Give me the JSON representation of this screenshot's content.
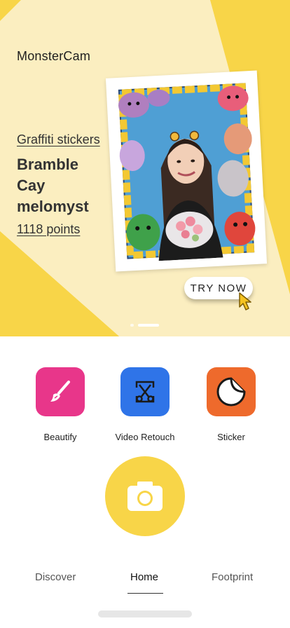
{
  "app": {
    "title": "MonsterCam"
  },
  "banner": {
    "category": "Graffiti stickers",
    "name": "Bramble Cay melomyst",
    "points": "1118 points",
    "cta": "TRY NOW",
    "colors": {
      "yellow": "#f8d548",
      "cream": "#fbeec0"
    }
  },
  "features": [
    {
      "label": "Beautify",
      "icon": "brush-icon",
      "color": "#e8368a"
    },
    {
      "label": "Video Retouch",
      "icon": "video-cut-icon",
      "color": "#2f74e8"
    },
    {
      "label": "Sticker",
      "icon": "sticker-icon",
      "color": "#ee6a2c"
    }
  ],
  "camera": {
    "icon": "camera-icon",
    "color": "#f8d548"
  },
  "nav": [
    {
      "label": "Discover"
    },
    {
      "label": "Home",
      "active": true
    },
    {
      "label": "Footprint"
    }
  ]
}
